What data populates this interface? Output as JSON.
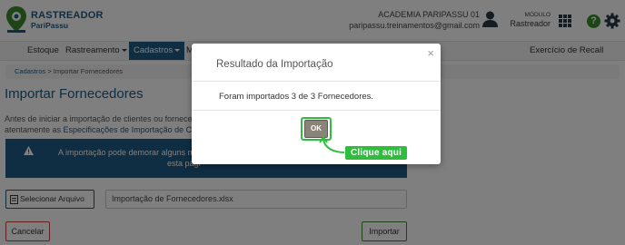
{
  "app": {
    "brand_line1": "RASTREADOR",
    "brand_line2": "PariPassu",
    "account_name": "ACADEMIA PARIPASSU 01",
    "account_email": "paripassu.treinamentos@gmail.com",
    "module_caption": "MÓDULO",
    "module_name": "Rastreador"
  },
  "nav": {
    "items": [
      "Estoque",
      "Rastreamento",
      "Cadastros",
      "M"
    ],
    "right_item": "Exercício de Recall"
  },
  "breadcrumb": {
    "root": "Cadastros",
    "separator": ">",
    "current": "Importar Fornecedores"
  },
  "page": {
    "title": "Importar Fornecedores",
    "intro_line1": "Antes de iniciar a importação de clientes ou fornece",
    "intro_line2_prefix": "atentamente as ",
    "intro_line2_link": "Especificações de Importação de Cli",
    "warning_line1": "A importação pode demorar alguns m",
    "warning_line2": "esta pági",
    "select_file_label": "Selecionar Arquivo",
    "file_name": "Importação de Fornecedores.xlsx",
    "cancel_label": "Cancelar",
    "import_label": "Importar"
  },
  "modal": {
    "title": "Resultado da Importação",
    "close_glyph": "×",
    "message": "Foram importados 3 de 3 Fornecedores.",
    "ok_label": "OK"
  },
  "annotation": {
    "label": "Clique aqui",
    "color": "#2fbd3e"
  },
  "colors": {
    "brand_blue": "#1e5b86",
    "brand_green": "#3a8a2c",
    "cancel_red": "#c9453e"
  }
}
